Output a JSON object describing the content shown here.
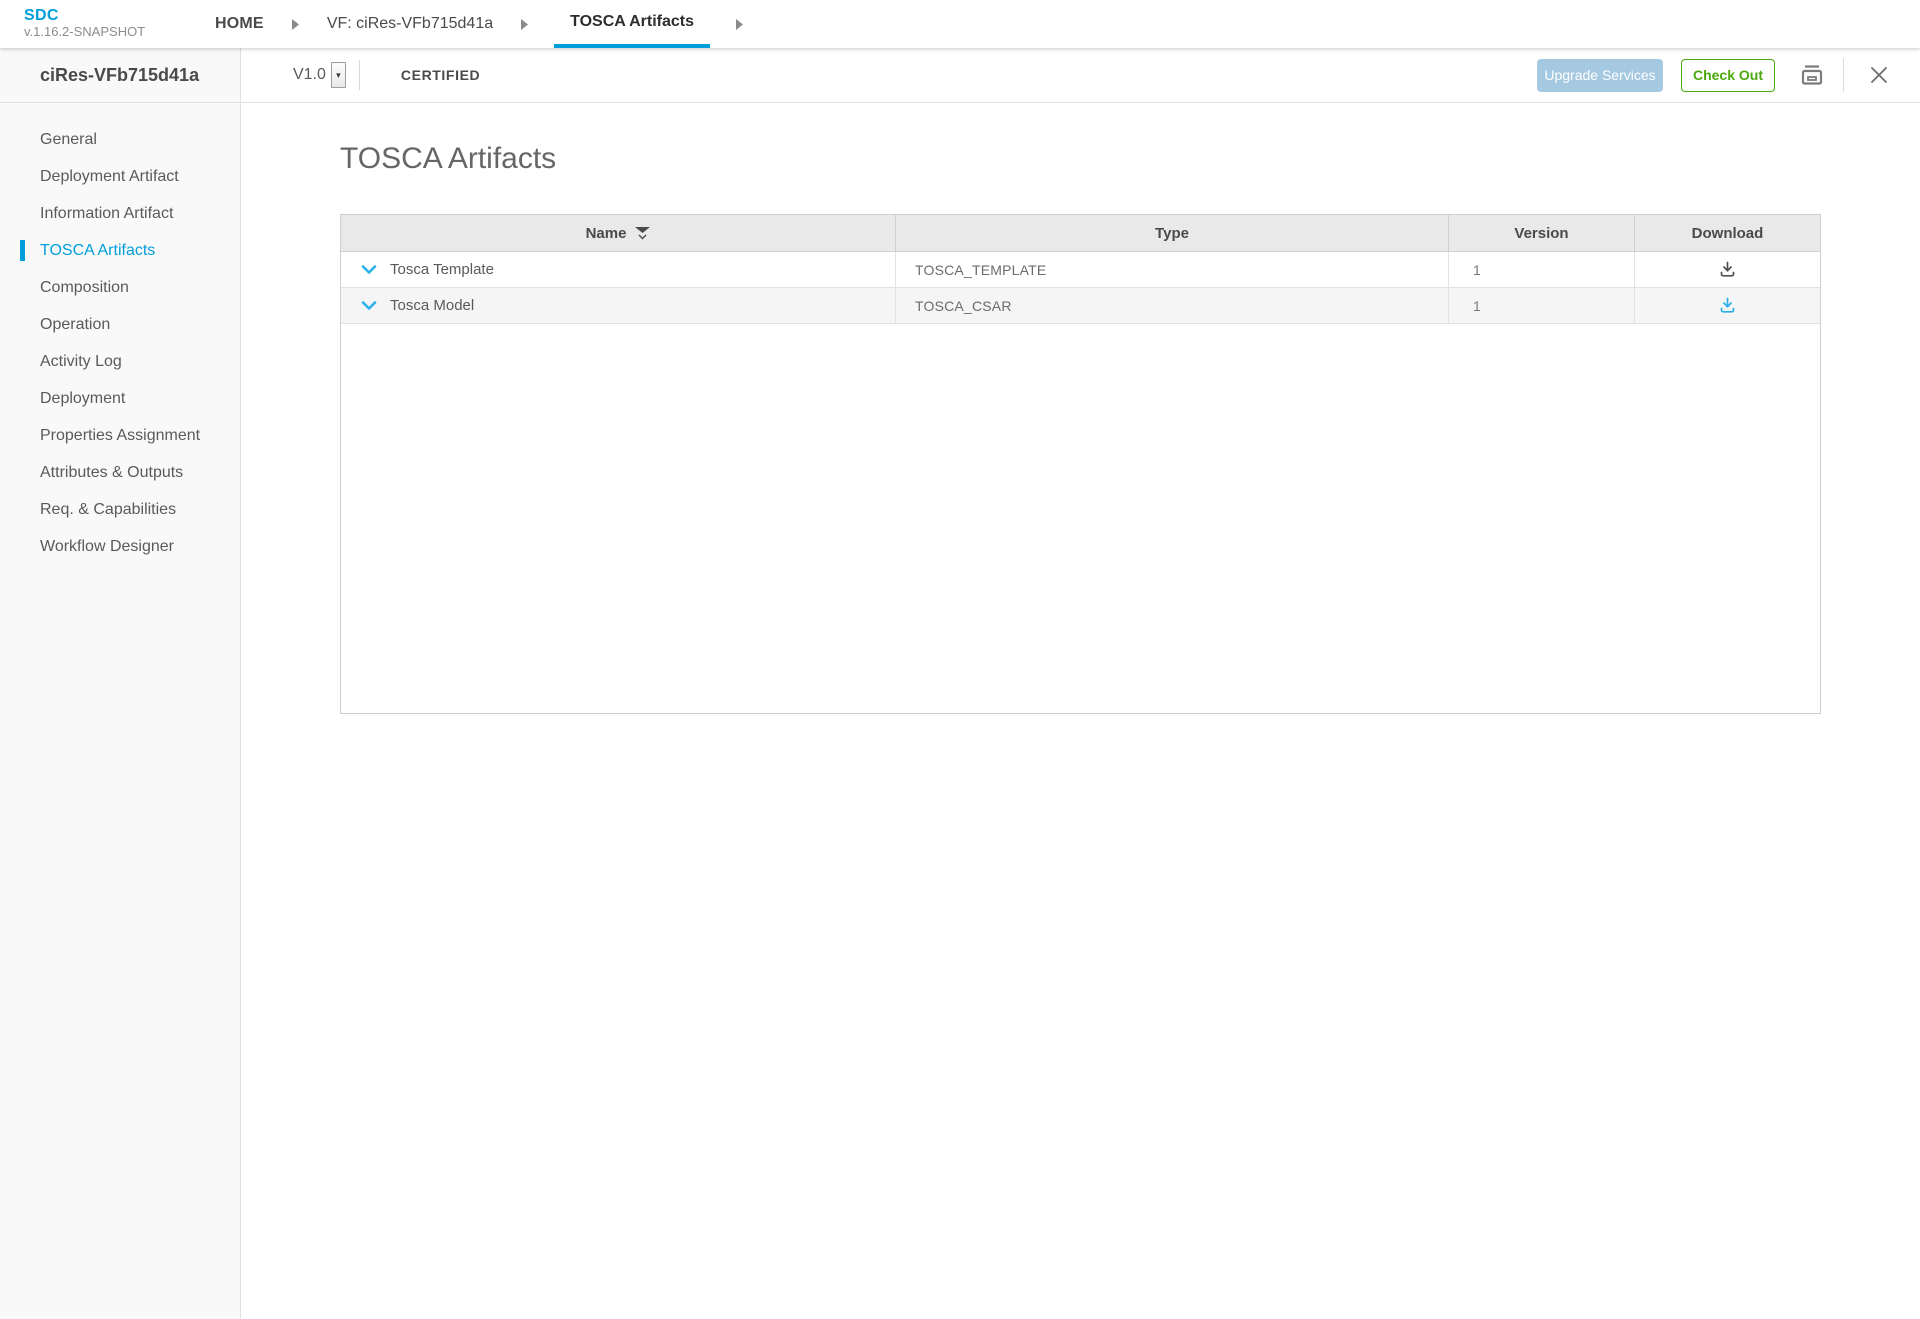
{
  "app": {
    "name": "SDC",
    "version": "v.1.16.2-SNAPSHOT"
  },
  "breadcrumb": {
    "items": [
      {
        "label": "HOME"
      },
      {
        "label": "VF: ciRes-VFb715d41a"
      },
      {
        "label": "TOSCA Artifacts"
      }
    ],
    "active": "TOSCA Artifacts"
  },
  "sidebar": {
    "title": "ciRes-VFb715d41a",
    "active_item": "TOSCA Artifacts",
    "items": [
      "General",
      "Deployment Artifact",
      "Information Artifact",
      "TOSCA Artifacts",
      "Composition",
      "Operation",
      "Activity Log",
      "Deployment",
      "Properties Assignment",
      "Attributes & Outputs",
      "Req. & Capabilities",
      "Workflow Designer"
    ]
  },
  "toolbar": {
    "version_selected": "V1.0",
    "version_caret": "▾",
    "status": "CERTIFIED",
    "upgrade_label": "Upgrade Services",
    "upgrade_disabled": true,
    "checkout_label": "Check Out"
  },
  "main": {
    "title": "TOSCA Artifacts",
    "table": {
      "columns": [
        "Name",
        "Type",
        "Version",
        "Download"
      ],
      "rows": [
        {
          "name": "Tosca Template",
          "type": "TOSCA_TEMPLATE",
          "version": "1"
        },
        {
          "name": "Tosca Model",
          "type": "TOSCA_CSAR",
          "version": "1"
        }
      ]
    }
  },
  "colors": {
    "accent": "#009fdb",
    "green": "#4ca90c",
    "upgrade-disabled": "#a6c9e2",
    "download-blue": "#2bb0ea"
  }
}
